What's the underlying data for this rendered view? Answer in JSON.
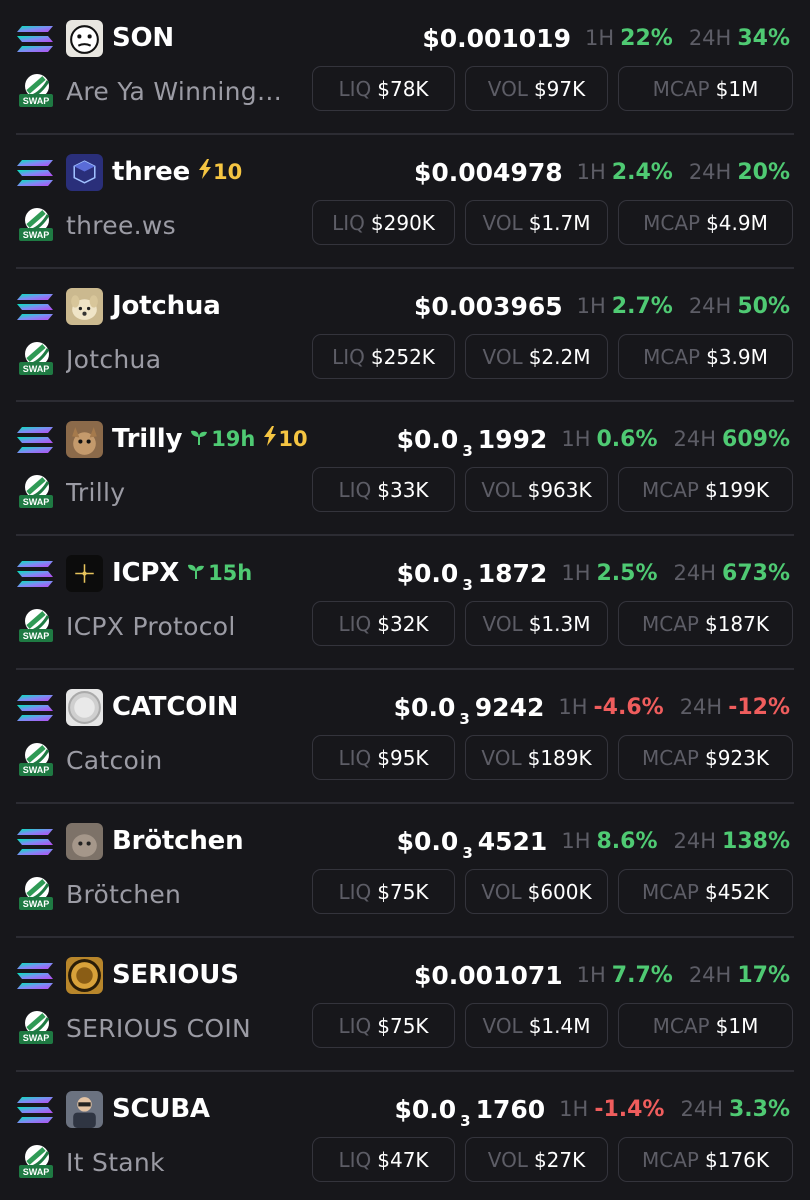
{
  "colors": {
    "background": "#17171b",
    "positive": "#4fca73",
    "negative": "#ef5d5d",
    "boost": "#f5c542",
    "muted": "#5d5d66"
  },
  "labels": {
    "h1": "1H",
    "h24": "24H",
    "liq": "LIQ",
    "vol": "VOL",
    "mcap": "MCAP",
    "swap": "SWAP"
  },
  "tokens": [
    {
      "symbol": "SON",
      "name": "Are Ya Winning,...",
      "price_main": "$0.001019",
      "price_sub": "",
      "price_tail": "",
      "h1": "22%",
      "h1_dir": "pos",
      "h24": "34%",
      "h24_dir": "pos",
      "liq": "$78K",
      "vol": "$97K",
      "mcap": "$1M",
      "age": "",
      "boost": "",
      "avatar_icon": "meme-face-icon",
      "avatar_color": "#e8e6e0"
    },
    {
      "symbol": "three",
      "name": "three.ws",
      "price_main": "$0.004978",
      "price_sub": "",
      "price_tail": "",
      "h1": "2.4%",
      "h1_dir": "pos",
      "h24": "20%",
      "h24_dir": "pos",
      "liq": "$290K",
      "vol": "$1.7M",
      "mcap": "$4.9M",
      "age": "",
      "boost": "10",
      "avatar_icon": "cube-logo-icon",
      "avatar_color": "#2a2f7a"
    },
    {
      "symbol": "Jotchua",
      "name": "Jotchua",
      "price_main": "$0.003965",
      "price_sub": "",
      "price_tail": "",
      "h1": "2.7%",
      "h1_dir": "pos",
      "h24": "50%",
      "h24_dir": "pos",
      "liq": "$252K",
      "vol": "$2.2M",
      "mcap": "$3.9M",
      "age": "",
      "boost": "",
      "avatar_icon": "dog-icon",
      "avatar_color": "#cbb98f"
    },
    {
      "symbol": "Trilly",
      "name": "Trilly",
      "price_main": "$0.0",
      "price_sub": "3",
      "price_tail": "1992",
      "h1": "0.6%",
      "h1_dir": "pos",
      "h24": "609%",
      "h24_dir": "pos",
      "liq": "$33K",
      "vol": "$963K",
      "mcap": "$199K",
      "age": "19h",
      "boost": "10",
      "avatar_icon": "squirrel-icon",
      "avatar_color": "#8b6a4a"
    },
    {
      "symbol": "ICPX",
      "name": "ICPX Protocol",
      "price_main": "$0.0",
      "price_sub": "3",
      "price_tail": "1872",
      "h1": "2.5%",
      "h1_dir": "pos",
      "h24": "673%",
      "h24_dir": "pos",
      "liq": "$32K",
      "vol": "$1.3M",
      "mcap": "$187K",
      "age": "15h",
      "boost": "",
      "avatar_icon": "crosshair-logo-icon",
      "avatar_color": "#0c0c0c"
    },
    {
      "symbol": "CATCOIN",
      "name": "Catcoin",
      "price_main": "$0.0",
      "price_sub": "3",
      "price_tail": "9242",
      "h1": "-4.6%",
      "h1_dir": "neg",
      "h24": "-12%",
      "h24_dir": "neg",
      "liq": "$95K",
      "vol": "$189K",
      "mcap": "$923K",
      "age": "",
      "boost": "",
      "avatar_icon": "silver-coin-icon",
      "avatar_color": "#e6e6e6"
    },
    {
      "symbol": "Brötchen",
      "name": "Brötchen",
      "price_main": "$0.0",
      "price_sub": "3",
      "price_tail": "4521",
      "h1": "8.6%",
      "h1_dir": "pos",
      "h24": "138%",
      "h24_dir": "pos",
      "liq": "$75K",
      "vol": "$600K",
      "mcap": "$452K",
      "age": "",
      "boost": "",
      "avatar_icon": "pet-photo-icon",
      "avatar_color": "#7d7268"
    },
    {
      "symbol": "SERIOUS",
      "name": "SERIOUS COIN",
      "price_main": "$0.001071",
      "price_sub": "",
      "price_tail": "",
      "h1": "7.7%",
      "h1_dir": "pos",
      "h24": "17%",
      "h24_dir": "pos",
      "liq": "$75K",
      "vol": "$1.4M",
      "mcap": "$1M",
      "age": "",
      "boost": "",
      "avatar_icon": "gold-coin-icon",
      "avatar_color": "#b8862b"
    },
    {
      "symbol": "SCUBA",
      "name": "It Stank",
      "price_main": "$0.0",
      "price_sub": "3",
      "price_tail": "1760",
      "h1": "-1.4%",
      "h1_dir": "neg",
      "h24": "3.3%",
      "h24_dir": "pos",
      "liq": "$47K",
      "vol": "$27K",
      "mcap": "$176K",
      "age": "",
      "boost": "",
      "avatar_icon": "person-photo-icon",
      "avatar_color": "#6b7280"
    }
  ]
}
